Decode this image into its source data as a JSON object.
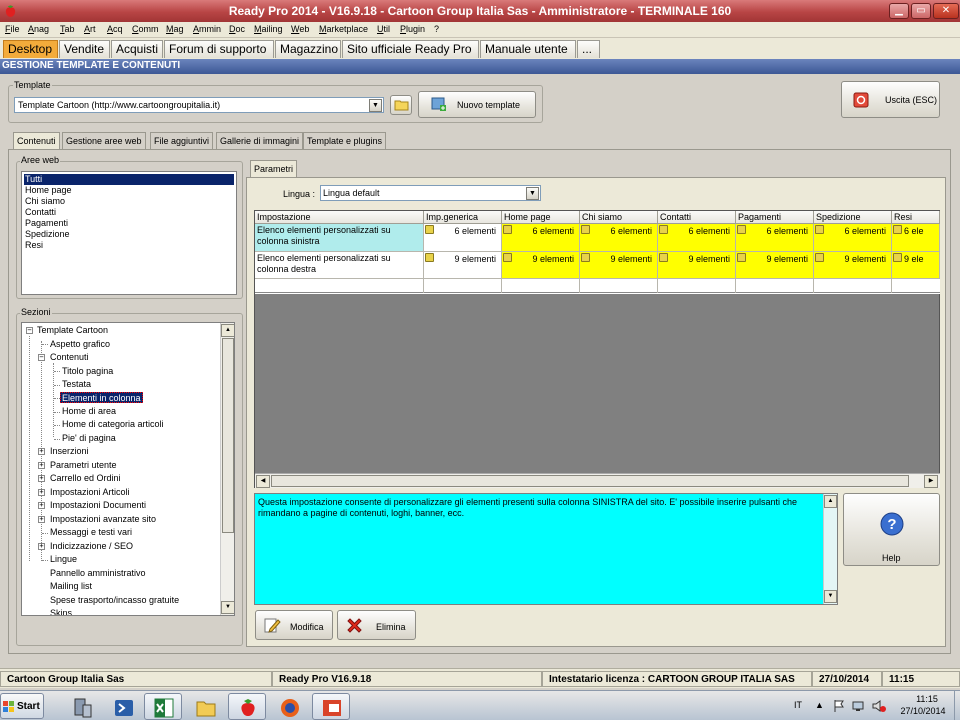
{
  "window": {
    "title": "Ready Pro 2014 - V16.9.18 - Cartoon Group Italia Sas - Amministratore - TERMINALE 160",
    "minimize": "▁",
    "maximize": "▭",
    "close": "✕"
  },
  "menu": [
    "File",
    "Anag",
    "Tab",
    "Art",
    "Acq",
    "Comm",
    "Mag",
    "Ammin",
    "Doc",
    "Mailing",
    "Web",
    "Marketplace",
    "Util",
    "Plugin",
    "?"
  ],
  "main_tabs": [
    "Desktop",
    "Vendite",
    "Acquisti",
    "Forum di supporto",
    "Magazzino",
    "Sito ufficiale Ready Pro",
    "Manuale utente",
    "..."
  ],
  "section_title": "GESTIONE TEMPLATE E CONTENUTI",
  "template": {
    "label": "Template",
    "selected": "Template Cartoon (http://www.cartoongroupitalia.it)",
    "new_button": "Nuovo template",
    "exit_button": "Uscita (ESC)"
  },
  "sub_tabs": [
    "Contenuti",
    "Gestione aree web",
    "File aggiuntivi",
    "Gallerie di immagini",
    "Template e plugins"
  ],
  "aree_web": {
    "label": "Aree web",
    "items": [
      "Tutti",
      "Home page",
      "Chi siamo",
      "Contatti",
      "Pagamenti",
      "Spedizione",
      "Resi"
    ],
    "selected": "Tutti"
  },
  "sezioni": {
    "label": "Sezioni",
    "nodes": {
      "root": "Template Cartoon",
      "aspetto": "Aspetto grafico",
      "contenuti": "Contenuti",
      "titolo": "Titolo pagina",
      "testata": "Testata",
      "elementi": "Elementi in colonna",
      "home_area": "Home di area",
      "home_cat": "Home di categoria articoli",
      "pie": "Pie' di pagina",
      "inserzioni": "Inserzioni",
      "parametri": "Parametri utente",
      "carrello": "Carrello ed Ordini",
      "imp_art": "Impostazioni Articoli",
      "imp_doc": "Impostazioni Documenti",
      "imp_av": "Impostazioni avanzate sito",
      "messaggi": "Messaggi e testi vari",
      "indicizzazione": "Indicizzazione / SEO",
      "lingue": "Lingue",
      "pannello": "Pannello amministrativo",
      "mailing": "Mailing list",
      "spese": "Spese trasporto/incasso gratuite",
      "skins": "Skins"
    }
  },
  "parametri": {
    "tab": "Parametri",
    "lingua_label": "Lingua :",
    "lingua_value": "Lingua default"
  },
  "grid": {
    "columns": [
      "Impostazione",
      "Imp.generica",
      "Home page",
      "Chi siamo",
      "Contatti",
      "Pagamenti",
      "Spedizione",
      "Resi"
    ],
    "rows": [
      {
        "setting": "Elenco elementi personalizzati su colonna sinistra",
        "values": [
          "6 elementi",
          "6 elementi",
          "6 elementi",
          "6 elementi",
          "6 elementi",
          "6 elementi",
          "6 ele"
        ]
      },
      {
        "setting": "Elenco elementi personalizzati su colonna destra",
        "values": [
          "9 elementi",
          "9 elementi",
          "9 elementi",
          "9 elementi",
          "9 elementi",
          "9 elementi",
          "9 ele"
        ]
      }
    ]
  },
  "description": "Questa impostazione consente di personalizzare gli elementi presenti sulla colonna SINISTRA del sito. E' possibile inserire pulsanti che rimandano a pagine di contenuti, loghi, banner, ecc.",
  "buttons": {
    "help": "Help",
    "modifica": "Modifica",
    "elimina": "Elimina"
  },
  "status": {
    "company": "Cartoon Group Italia Sas",
    "version": "Ready Pro V16.9.18",
    "license": "Intestatario licenza : CARTOON GROUP ITALIA SAS",
    "date": "27/10/2014",
    "time": "11:15"
  },
  "taskbar": {
    "start": "Start",
    "lang": "IT",
    "clock_time": "11:15",
    "clock_date": "27/10/2014"
  },
  "colors": {
    "titlebar": "#b84545",
    "active_tab": "#f3ab3b",
    "header": "#3c5795",
    "grid_highlight": "#ffff00",
    "description_bg": "#00ffff",
    "selected_cell": "#b0ecec"
  }
}
